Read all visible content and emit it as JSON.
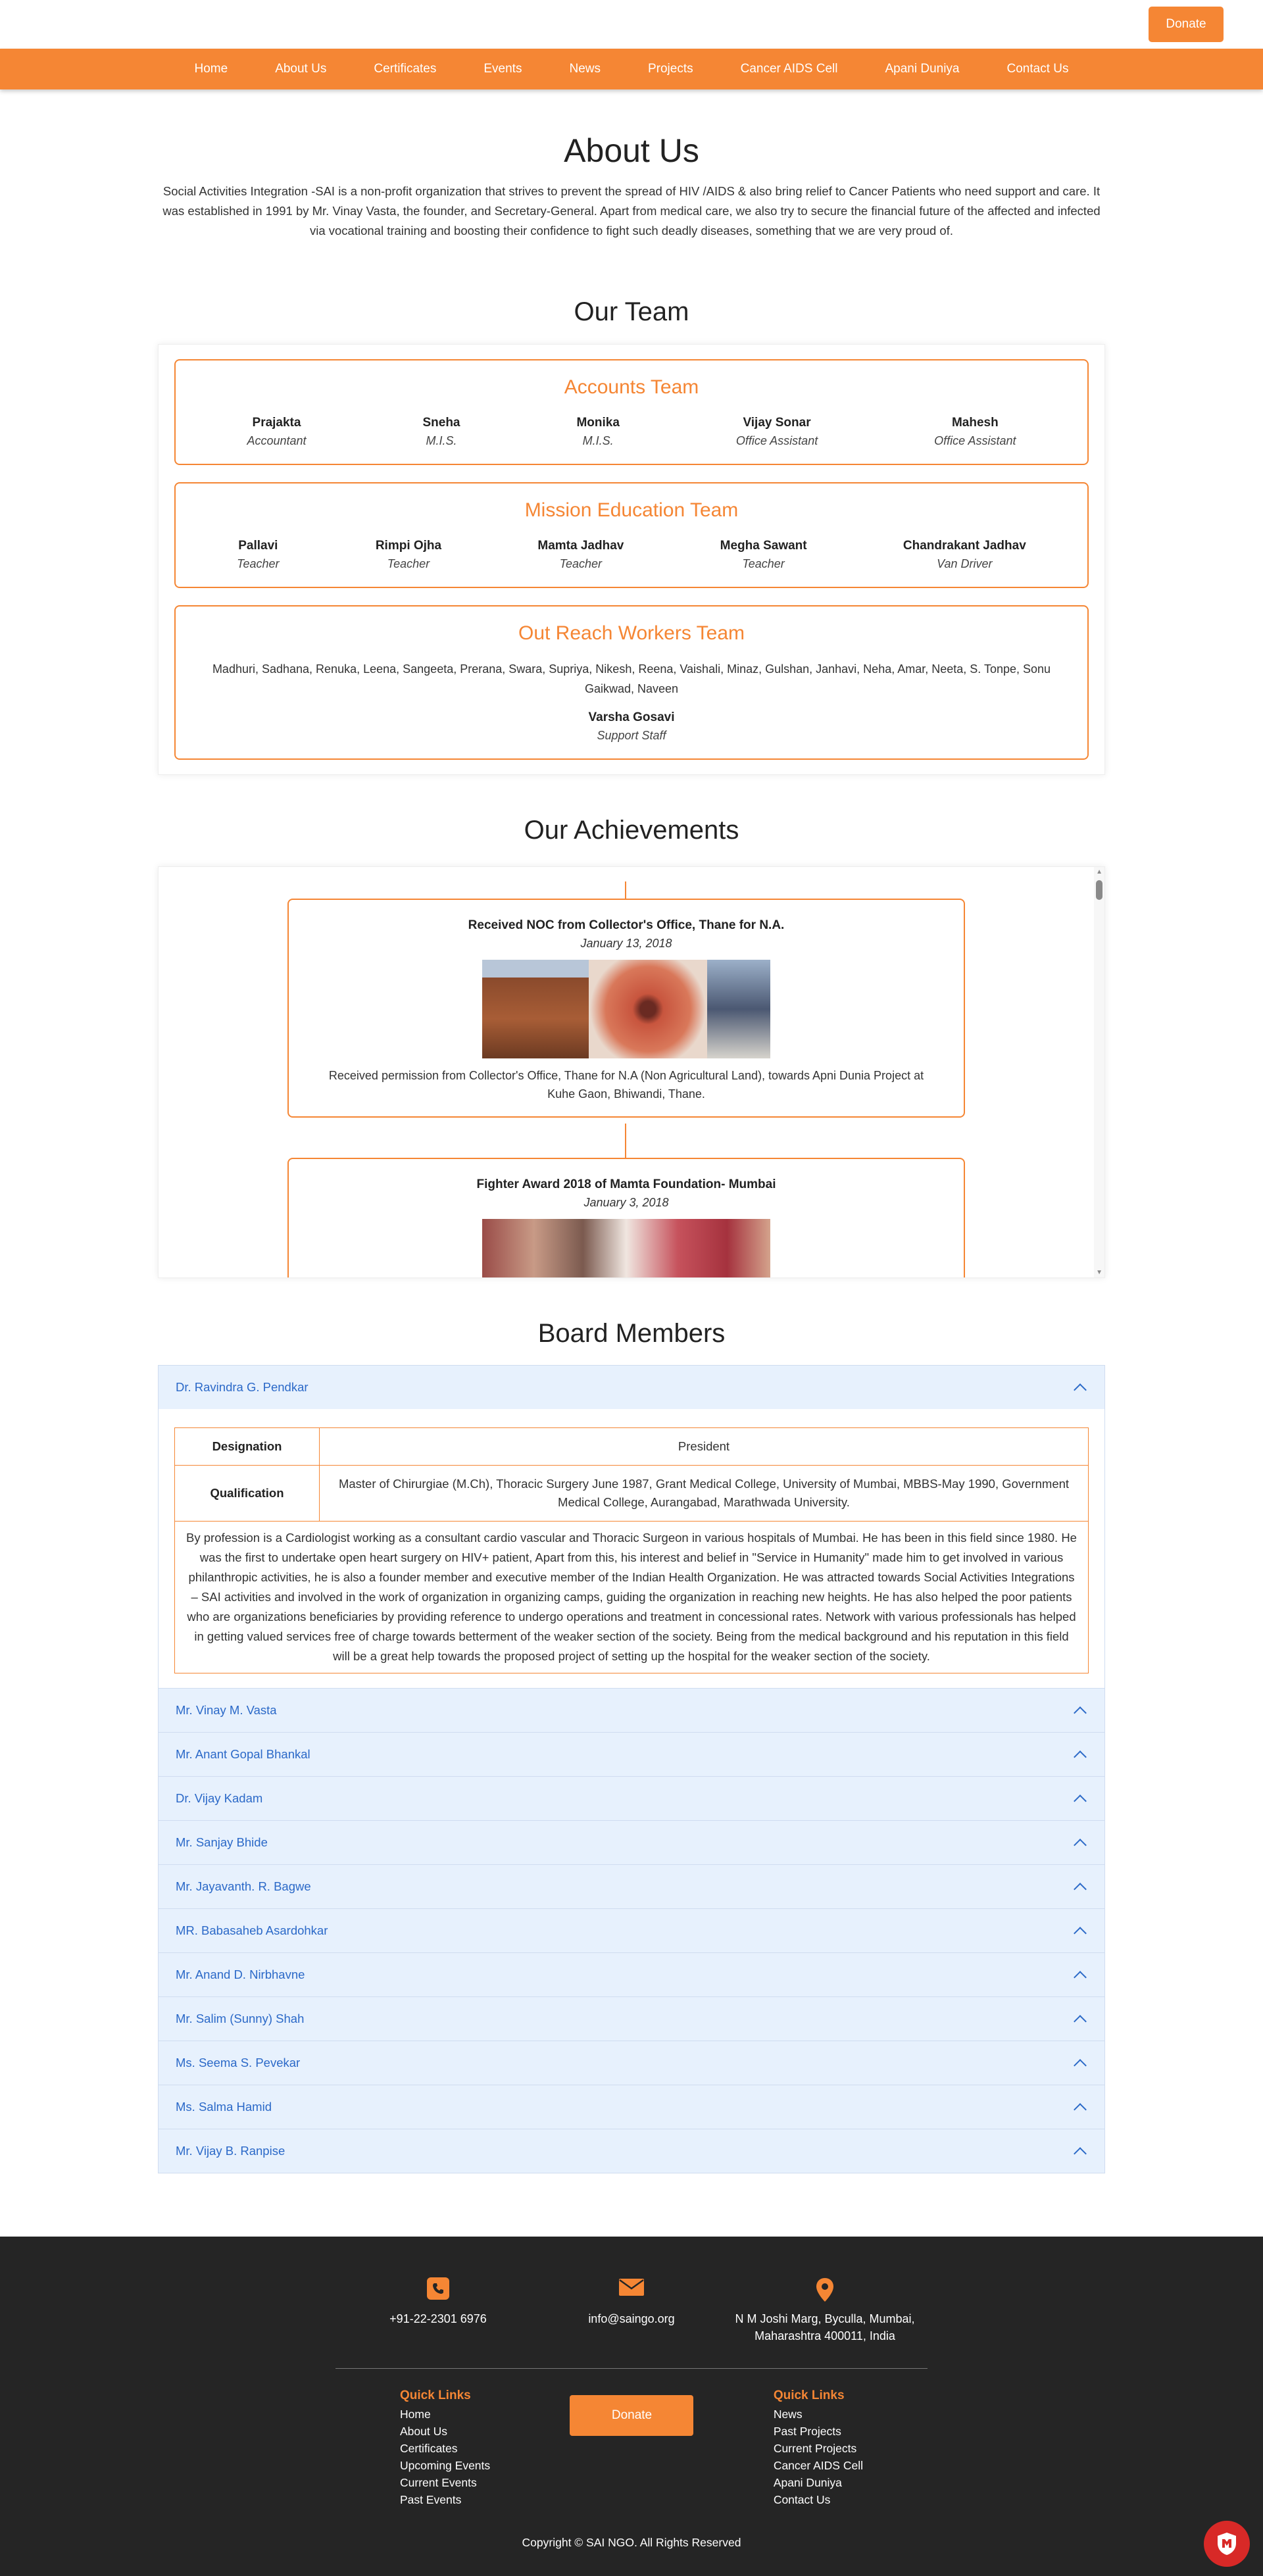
{
  "header": {
    "donate_label": "Donate"
  },
  "nav": [
    "Home",
    "About Us",
    "Certificates",
    "Events",
    "News",
    "Projects",
    "Cancer AIDS Cell",
    "Apani Duniya",
    "Contact Us"
  ],
  "about": {
    "title": "About Us",
    "text": "Social Activities Integration -SAI is a non-profit organization that strives to prevent the spread of HIV /AIDS & also bring relief to Cancer Patients who need support and care. It was established in 1991 by Mr. Vinay Vasta, the founder, and Secretary-General. Apart from medical care, we also try to secure the financial future of the affected and infected via vocational training and boosting their confidence to fight such deadly diseases, something that we are very proud of."
  },
  "team": {
    "title": "Our Team",
    "accounts": {
      "title": "Accounts Team",
      "members": [
        {
          "name": "Prajakta",
          "role": "Accountant"
        },
        {
          "name": "Sneha",
          "role": "M.I.S."
        },
        {
          "name": "Monika",
          "role": "M.I.S."
        },
        {
          "name": "Vijay Sonar",
          "role": "Office Assistant"
        },
        {
          "name": "Mahesh",
          "role": "Office Assistant"
        }
      ]
    },
    "education": {
      "title": "Mission Education Team",
      "members": [
        {
          "name": "Pallavi",
          "role": "Teacher"
        },
        {
          "name": "Rimpi Ojha",
          "role": "Teacher"
        },
        {
          "name": "Mamta Jadhav",
          "role": "Teacher"
        },
        {
          "name": "Megha Sawant",
          "role": "Teacher"
        },
        {
          "name": "Chandrakant Jadhav",
          "role": "Van Driver"
        }
      ]
    },
    "outreach": {
      "title": "Out Reach Workers Team",
      "names": "Madhuri, Sadhana, Renuka, Leena, Sangeeta, Prerana, Swara, Supriya, Nikesh, Reena, Vaishali, Minaz, Gulshan, Janhavi, Neha, Amar, Neeta, S. Tonpe, Sonu Gaikwad, Naveen",
      "staff_name": "Varsha Gosavi",
      "staff_role": "Support Staff"
    }
  },
  "achievements": {
    "title": "Our Achievements",
    "items": [
      {
        "title": "Received NOC from Collector's Office, Thane for N.A.",
        "date": "January 13, 2018",
        "description": "Received permission from Collector's Office, Thane for N.A (Non Agricultural Land), towards Apni Dunia Project at Kuhe Gaon, Bhiwandi, Thane."
      },
      {
        "title": "Fighter Award 2018 of Mamta Foundation- Mumbai",
        "date": "January 3, 2018",
        "description": ""
      }
    ]
  },
  "board": {
    "title": "Board Members",
    "expanded": {
      "name": "Dr. Ravindra G. Pendkar",
      "designation_label": "Designation",
      "designation": "President",
      "qualification_label": "Qualification",
      "qualification": "Master of Chirurgiae (M.Ch), Thoracic Surgery June 1987, Grant Medical College, University of Mumbai, MBBS-May 1990, Government Medical College, Aurangabad, Marathwada University.",
      "bio": "By profession is a Cardiologist working as a consultant cardio vascular and Thoracic Surgeon in various hospitals of Mumbai. He has been in this field since 1980. He was the first to undertake open heart surgery on HIV+ patient, Apart from this, his interest and belief in \"Service in Humanity\" made him to get involved in various philanthropic activities, he is also a founder member and executive member of the Indian Health Organization. He was attracted towards Social Activities Integrations – SAI activities and involved in the work of organization in organizing camps, guiding the organization in reaching new heights. He has also helped the poor patients who are organizations beneficiaries by providing reference to undergo operations and treatment in concessional rates. Network with various professionals has helped in getting valued services free of charge towards betterment of the weaker section of the society. Being from the medical background and his reputation in this field will be a great help towards the proposed project of setting up the hospital for the weaker section of the society."
    },
    "collapsed": [
      "Mr. Vinay M. Vasta",
      "Mr. Anant Gopal Bhankal",
      "Dr. Vijay Kadam",
      "Mr. Sanjay Bhide",
      "Mr. Jayavanth. R. Bagwe",
      "MR. Babasaheb Asardohkar",
      "Mr. Anand D. Nirbhavne",
      "Mr. Salim (Sunny) Shah",
      "Ms. Seema S. Pevekar",
      "Ms. Salma Hamid",
      "Mr. Vijay B. Ranpise"
    ]
  },
  "footer": {
    "phone": "+91-22-2301 6976",
    "email": "info@saingo.org",
    "address_line1": "N M Joshi Marg, Byculla, Mumbai,",
    "address_line2": "Maharashtra 400011, India",
    "quick_links_left_title": "Quick Links",
    "quick_links_left": [
      "Home",
      "About Us",
      "Certificates",
      "Upcoming Events",
      "Current Events",
      "Past Events"
    ],
    "donate_label": "Donate",
    "quick_links_right_title": "Quick Links",
    "quick_links_right": [
      "News",
      "Past Projects",
      "Current Projects",
      "Cancer AIDS Cell",
      "Apani Duniya",
      "Contact Us"
    ],
    "copyright": "Copyright © SAI NGO. All Rights Reserved"
  },
  "colors": {
    "brand": "#f58634",
    "accordion_bg": "#e7f1fd",
    "accordion_text": "#2b69c8",
    "footer_bg": "#252525"
  },
  "icons": [
    "phone-icon",
    "envelope-icon",
    "map-pin-icon",
    "chevron-up-icon",
    "shield-icon"
  ]
}
